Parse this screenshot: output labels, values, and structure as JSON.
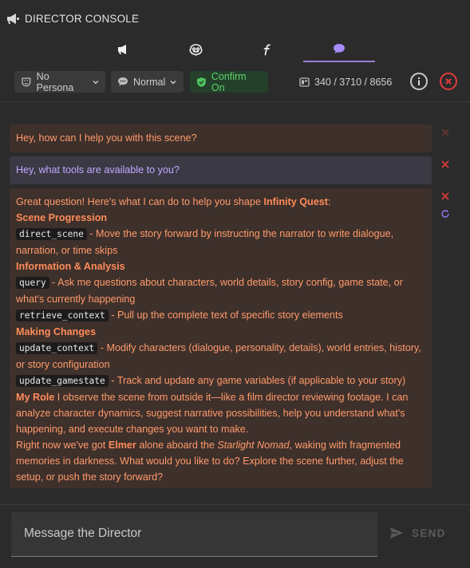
{
  "header": {
    "title": "DIRECTOR CONSOLE",
    "icon": "megaphone-icon",
    "tabs": [
      {
        "icon": "megaphone-icon",
        "active": false
      },
      {
        "icon": "brain-icon",
        "active": false
      },
      {
        "icon": "function-icon",
        "active": false
      },
      {
        "icon": "chat-bubble-icon",
        "active": true
      }
    ],
    "accent": "#9b7fd8"
  },
  "toolbar": {
    "persona_label": "No Persona",
    "mode_label": "Normal",
    "confirm_label": "Confirm On",
    "tokens": "340 / 3710 / 8656"
  },
  "messages": {
    "m1": "Hey, how can I help you with this scene?",
    "m2": "Hey, what tools are available to you?",
    "m3": {
      "intro_a": "Great question! Here's what I can do to help you shape ",
      "intro_story": "Infinity Quest",
      "intro_b": ":",
      "h1": "Scene Progression",
      "t1": "direct_scene",
      "d1": " - Move the story forward by instructing the narrator to write dialogue, narration, or time skips",
      "h2": "Information & Analysis",
      "t2": "query",
      "d2": " - Ask me questions about characters, world details, story config, game state, or what's currently happening",
      "t3": "retrieve_context",
      "d3": " - Pull up the complete text of specific story elements",
      "h3": "Making Changes",
      "t4": "update_context",
      "d4": " - Modify characters (dialogue, personality, details), world entries, history, or story configuration",
      "t5": "update_gamestate",
      "d5": " - Track and update any game variables (if applicable to your story)",
      "role_label": "My Role",
      "role_text": " I observe the scene from outside it—like a film director reviewing footage. I can analyze character dynamics, suggest narrative possibilities, help you understand what's happening, and execute changes you want to make.",
      "close_a": "Right now we've got ",
      "close_name": "Elmer",
      "close_b": " alone aboard the ",
      "close_ship": "Starlight Nomad",
      "close_c": ", waking with fragmented memories in darkness. What would you like to do? Explore the scene further, adjust the setup, or push the story forward?"
    }
  },
  "composer": {
    "placeholder": "Message the Director",
    "send_label": "SEND"
  }
}
